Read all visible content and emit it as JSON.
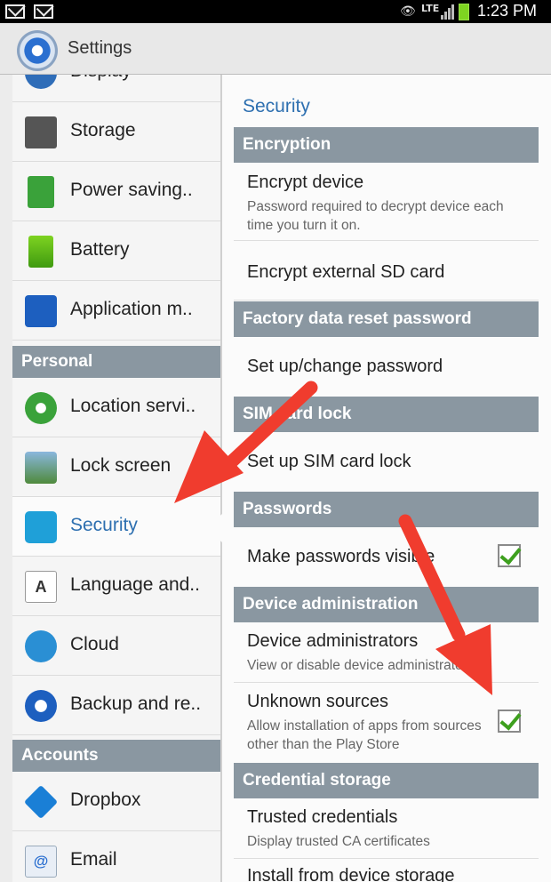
{
  "status_bar": {
    "time": "1:23 PM",
    "network": "LTE"
  },
  "app": {
    "title": "Settings"
  },
  "sidebar": {
    "items_top": [
      {
        "label": "Display",
        "icon": "display-icon"
      },
      {
        "label": "Storage",
        "icon": "storage-icon"
      },
      {
        "label": "Power saving..",
        "icon": "power-saving-icon"
      },
      {
        "label": "Battery",
        "icon": "battery-icon"
      },
      {
        "label": "Application m..",
        "icon": "application-manager-icon"
      }
    ],
    "personal_header": "Personal",
    "items_personal": [
      {
        "label": "Location servi..",
        "icon": "location-icon"
      },
      {
        "label": "Lock screen",
        "icon": "lock-screen-icon"
      },
      {
        "label": "Security",
        "icon": "security-lock-icon",
        "selected": true
      },
      {
        "label": "Language and..",
        "icon": "language-icon"
      },
      {
        "label": "Cloud",
        "icon": "cloud-icon"
      },
      {
        "label": "Backup and re..",
        "icon": "backup-icon"
      }
    ],
    "accounts_header": "Accounts",
    "items_accounts": [
      {
        "label": "Dropbox",
        "icon": "dropbox-icon"
      },
      {
        "label": "Email",
        "icon": "email-icon"
      }
    ]
  },
  "security": {
    "title": "Security",
    "encryption_header": "Encryption",
    "encrypt_device": {
      "title": "Encrypt device",
      "summary": "Password required to decrypt device each time you turn it on."
    },
    "encrypt_sd": {
      "title": "Encrypt external SD card"
    },
    "factory_header": "Factory data reset password",
    "setup_password": {
      "title": "Set up/change password"
    },
    "sim_header": "SIM card lock",
    "sim_lock": {
      "title": "Set up SIM card lock"
    },
    "passwords_header": "Passwords",
    "make_visible": {
      "title": "Make passwords visible",
      "checked": true
    },
    "device_admin_header": "Device administration",
    "device_admins": {
      "title": "Device administrators",
      "summary": "View or disable device administrators"
    },
    "unknown_sources": {
      "title": "Unknown sources",
      "summary": "Allow installation of apps from sources other than the Play Store",
      "checked": true
    },
    "credential_header": "Credential storage",
    "trusted_credentials": {
      "title": "Trusted credentials",
      "summary": "Display trusted CA certificates"
    },
    "install_storage": {
      "title": "Install from device storage"
    }
  },
  "colors": {
    "accent": "#2d6fb0",
    "header_bg": "#8a97a1",
    "annotation_arrow": "#f03c2e"
  }
}
